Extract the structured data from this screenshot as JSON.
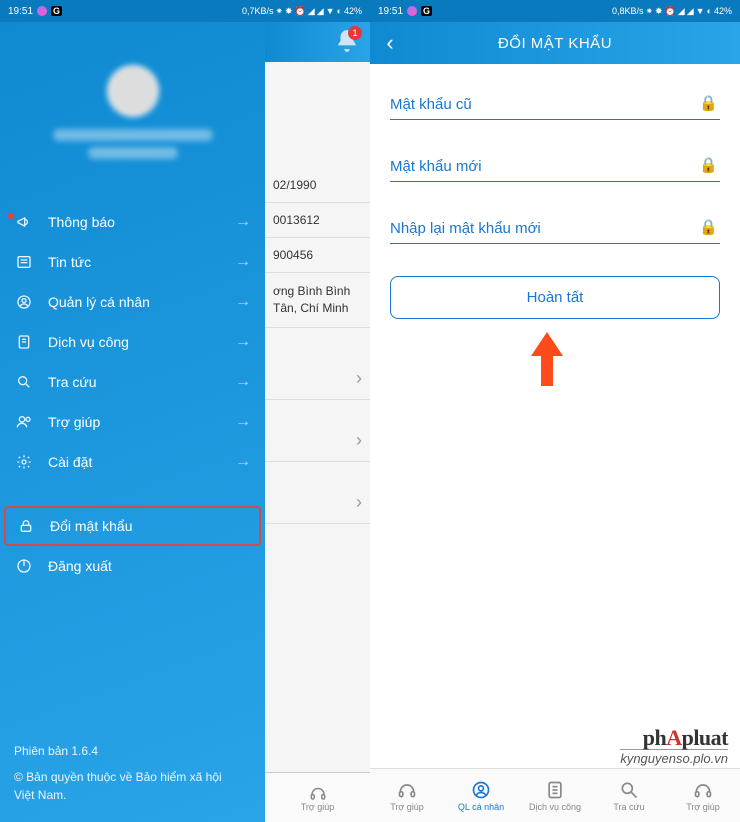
{
  "status": {
    "time": "19:51",
    "speed_left": "0,7KB/s",
    "speed_right": "0,8KB/s",
    "battery": "42%",
    "g_badge": "G"
  },
  "left": {
    "menu": [
      {
        "icon": "megaphone",
        "label": "Thông báo",
        "arrow": true,
        "dot": true
      },
      {
        "icon": "news",
        "label": "Tin tức",
        "arrow": true
      },
      {
        "icon": "profile",
        "label": "Quản lý cá nhân",
        "arrow": true
      },
      {
        "icon": "doc",
        "label": "Dịch vụ công",
        "arrow": true
      },
      {
        "icon": "search",
        "label": "Tra cứu",
        "arrow": true
      },
      {
        "icon": "help",
        "label": "Trợ giúp",
        "arrow": true
      },
      {
        "icon": "gear",
        "label": "Cài đặt",
        "arrow": true
      }
    ],
    "change_pw": "Đổi mật khẩu",
    "logout": "Đăng xuất",
    "version": "Phiên bản 1.6.4",
    "copyright": "© Bản quyền thuộc về  Bảo hiểm xã hội Việt Nam."
  },
  "peek": {
    "bell_count": "1",
    "rows": [
      "02/1990",
      "0013612",
      "900456",
      "ơng Bình Bình Tân, Chí Minh"
    ],
    "tab_label": "Trợ giúp"
  },
  "right": {
    "title": "ĐỔI MẬT KHẨU",
    "ph_old": "Mật khẩu cũ",
    "ph_new": "Mật khẩu mới",
    "ph_confirm": "Nhập lại mật khẩu mới",
    "submit": "Hoàn tất"
  },
  "tabs": [
    "Trợ giúp",
    "QL cá nhân",
    "Dịch vụ công",
    "Tra cứu",
    "Trợ giúp"
  ],
  "watermark": {
    "brand_a": "ph",
    "brand_b": "A",
    "brand_c": "pluat",
    "sub": "kynguyenso.plo.vn"
  }
}
